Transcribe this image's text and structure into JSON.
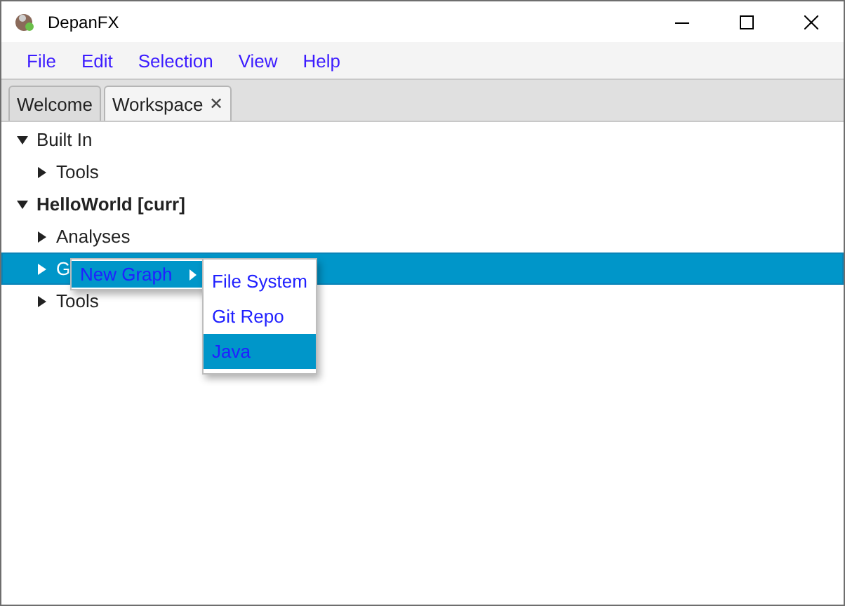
{
  "window": {
    "title": "DepanFX"
  },
  "menu_bar": [
    {
      "label": "File"
    },
    {
      "label": "Edit"
    },
    {
      "label": "Selection"
    },
    {
      "label": "View"
    },
    {
      "label": "Help"
    }
  ],
  "tabs": [
    {
      "label": "Welcome",
      "selected": false,
      "closable": false
    },
    {
      "label": "Workspace",
      "selected": true,
      "closable": true,
      "close": "✕"
    }
  ],
  "tree": [
    {
      "label": "Built In",
      "bold": false,
      "expanded": true,
      "selected": false,
      "children": [
        {
          "label": "Tools",
          "bold": false,
          "expanded": false,
          "selected": false
        }
      ]
    },
    {
      "label": "HelloWorld [curr]",
      "bold": true,
      "expanded": true,
      "selected": false,
      "children": [
        {
          "label": "Analyses",
          "bold": false,
          "expanded": false,
          "selected": false
        },
        {
          "label": "G",
          "bold": false,
          "expanded": false,
          "selected": true
        },
        {
          "label": "Tools",
          "bold": false,
          "expanded": false,
          "selected": false
        }
      ]
    }
  ],
  "context_menu": {
    "items": [
      {
        "label": "New Graph",
        "selected": true,
        "submenu": true
      }
    ],
    "submenu": {
      "items": [
        {
          "label": "File System",
          "selected": false
        },
        {
          "label": "Git Repo",
          "selected": false
        },
        {
          "label": "Java",
          "selected": true
        }
      ]
    }
  }
}
